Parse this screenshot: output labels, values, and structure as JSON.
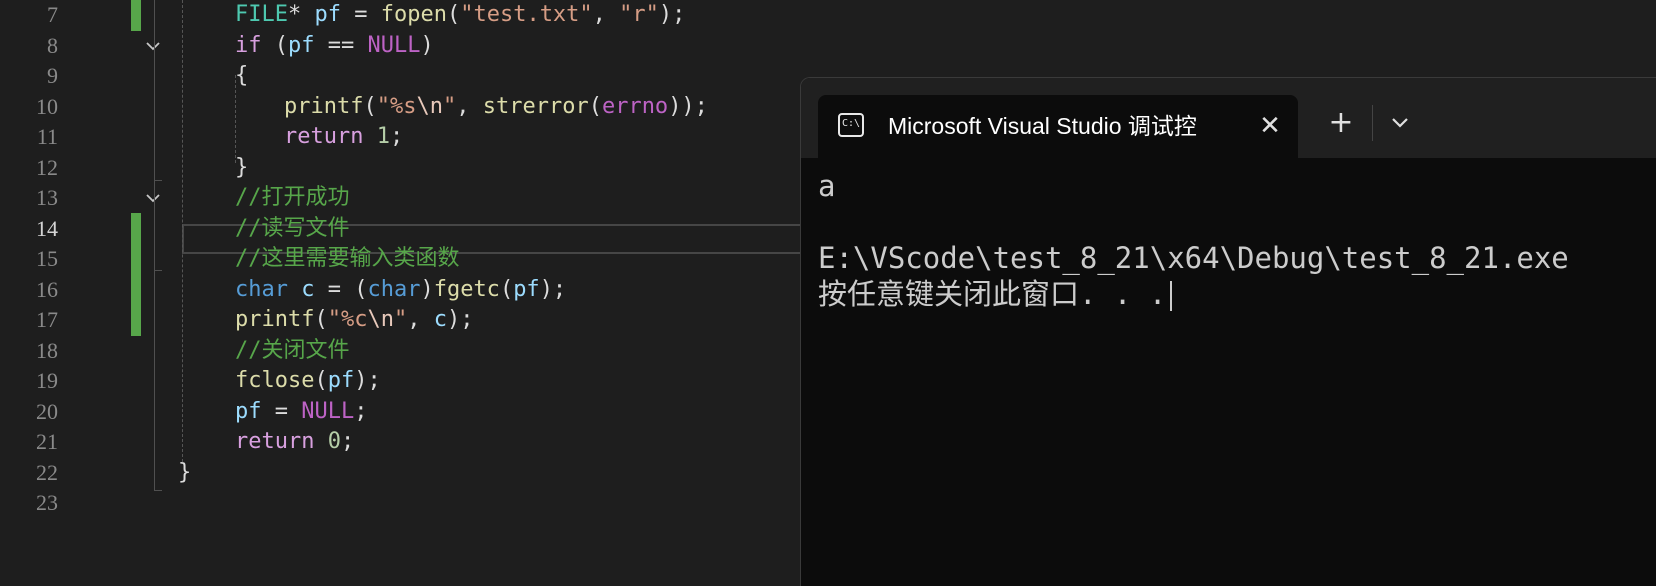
{
  "editor": {
    "current_line": 14,
    "lines": [
      {
        "n": "7",
        "changed": true,
        "fold": false,
        "tokens": [
          {
            "t": "FILE",
            "c": "type"
          },
          {
            "t": "* ",
            "c": "op"
          },
          {
            "t": "pf",
            "c": "var"
          },
          {
            "t": " = ",
            "c": "op"
          },
          {
            "t": "fopen",
            "c": "fn"
          },
          {
            "t": "(",
            "c": "op"
          },
          {
            "t": "\"test.txt\"",
            "c": "str"
          },
          {
            "t": ", ",
            "c": "op"
          },
          {
            "t": "\"r\"",
            "c": "str"
          },
          {
            "t": ");",
            "c": "op"
          }
        ]
      },
      {
        "n": "8",
        "changed": false,
        "fold": true,
        "tokens": [
          {
            "t": "if",
            "c": "ctl"
          },
          {
            "t": " (",
            "c": "op"
          },
          {
            "t": "pf",
            "c": "var"
          },
          {
            "t": " == ",
            "c": "op"
          },
          {
            "t": "NULL",
            "c": "mac"
          },
          {
            "t": ")",
            "c": "op"
          }
        ]
      },
      {
        "n": "9",
        "changed": false,
        "fold": false,
        "tokens": [
          {
            "t": "{",
            "c": "op"
          }
        ]
      },
      {
        "n": "10",
        "changed": false,
        "fold": false,
        "indent": 1,
        "tokens": [
          {
            "t": "printf",
            "c": "fn"
          },
          {
            "t": "(",
            "c": "op"
          },
          {
            "t": "\"%s",
            "c": "str"
          },
          {
            "t": "\\n",
            "c": "esc"
          },
          {
            "t": "\"",
            "c": "str"
          },
          {
            "t": ", ",
            "c": "op"
          },
          {
            "t": "strerror",
            "c": "fn"
          },
          {
            "t": "(",
            "c": "op"
          },
          {
            "t": "errno",
            "c": "mac"
          },
          {
            "t": "));",
            "c": "op"
          }
        ]
      },
      {
        "n": "11",
        "changed": false,
        "fold": false,
        "indent": 1,
        "tokens": [
          {
            "t": "return",
            "c": "ctl"
          },
          {
            "t": " ",
            "c": "op"
          },
          {
            "t": "1",
            "c": "num"
          },
          {
            "t": ";",
            "c": "op"
          }
        ]
      },
      {
        "n": "12",
        "changed": false,
        "fold": false,
        "tokens": [
          {
            "t": "}",
            "c": "op"
          }
        ]
      },
      {
        "n": "13",
        "changed": false,
        "fold": true,
        "tokens": [
          {
            "t": "//打开成功",
            "c": "cm"
          }
        ]
      },
      {
        "n": "14",
        "changed": true,
        "fold": false,
        "tokens": [
          {
            "t": "//读写文件",
            "c": "cm"
          }
        ]
      },
      {
        "n": "15",
        "changed": true,
        "fold": false,
        "tokens": [
          {
            "t": "//这里需要输入类函数",
            "c": "cm"
          }
        ]
      },
      {
        "n": "16",
        "changed": true,
        "fold": false,
        "tokens": [
          {
            "t": "char",
            "c": "kw"
          },
          {
            "t": " ",
            "c": "op"
          },
          {
            "t": "c",
            "c": "var"
          },
          {
            "t": " = (",
            "c": "op"
          },
          {
            "t": "char",
            "c": "kw"
          },
          {
            "t": ")",
            "c": "op"
          },
          {
            "t": "fgetc",
            "c": "fn"
          },
          {
            "t": "(",
            "c": "op"
          },
          {
            "t": "pf",
            "c": "var"
          },
          {
            "t": ");",
            "c": "op"
          }
        ]
      },
      {
        "n": "17",
        "changed": true,
        "fold": false,
        "tokens": [
          {
            "t": "printf",
            "c": "fn"
          },
          {
            "t": "(",
            "c": "op"
          },
          {
            "t": "\"%c",
            "c": "str"
          },
          {
            "t": "\\n",
            "c": "esc"
          },
          {
            "t": "\"",
            "c": "str"
          },
          {
            "t": ", ",
            "c": "op"
          },
          {
            "t": "c",
            "c": "var"
          },
          {
            "t": ");",
            "c": "op"
          }
        ]
      },
      {
        "n": "18",
        "changed": false,
        "fold": false,
        "tokens": [
          {
            "t": "//关闭文件",
            "c": "cm"
          }
        ]
      },
      {
        "n": "19",
        "changed": false,
        "fold": false,
        "tokens": [
          {
            "t": "fclose",
            "c": "fn"
          },
          {
            "t": "(",
            "c": "op"
          },
          {
            "t": "pf",
            "c": "var"
          },
          {
            "t": ");",
            "c": "op"
          }
        ]
      },
      {
        "n": "20",
        "changed": false,
        "fold": false,
        "tokens": [
          {
            "t": "pf",
            "c": "var"
          },
          {
            "t": " = ",
            "c": "op"
          },
          {
            "t": "NULL",
            "c": "mac"
          },
          {
            "t": ";",
            "c": "op"
          }
        ]
      },
      {
        "n": "21",
        "changed": false,
        "fold": false,
        "tokens": [
          {
            "t": "return",
            "c": "ctl"
          },
          {
            "t": " ",
            "c": "op"
          },
          {
            "t": "0",
            "c": "num"
          },
          {
            "t": ";",
            "c": "op"
          }
        ]
      },
      {
        "n": "22",
        "changed": false,
        "fold": false,
        "outdent": true,
        "tokens": [
          {
            "t": "}",
            "c": "op"
          }
        ]
      },
      {
        "n": "23",
        "changed": false,
        "fold": false,
        "tokens": []
      }
    ]
  },
  "terminal": {
    "tab_title": "Microsoft Visual Studio 调试控",
    "tab_icon_text": "C:\\",
    "close_glyph": "✕",
    "new_tab_glyph": "+",
    "output_lines": [
      "a",
      "",
      "E:\\VScode\\test_8_21\\x64\\Debug\\test_8_21.exe",
      "按任意键关闭此窗口. . ."
    ]
  },
  "icons": {
    "fold": "chevron-down-icon",
    "terminal": "console-icon",
    "close": "close-icon",
    "new_tab": "plus-icon",
    "dropdown": "chevron-down-icon"
  },
  "colors": {
    "editor_bg": "#1e1e1e",
    "terminal_bg": "#0c0c0c",
    "change_bar": "#57a64a",
    "comment": "#57a64a",
    "keyword": "#569cd6",
    "control": "#d8a0df",
    "function": "#dcdcaa",
    "string": "#d69d85",
    "variable": "#9cdcfe",
    "type": "#4ec9b0"
  }
}
